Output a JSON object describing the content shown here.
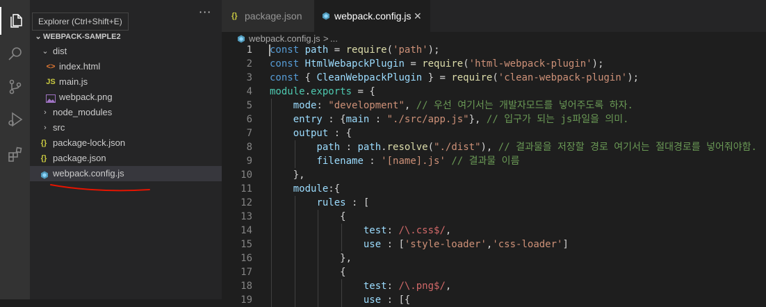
{
  "tooltip": "Explorer (Ctrl+Shift+E)",
  "sidebar": {
    "more": "···",
    "root": "WEBPACK-SAMPLE2",
    "items": [
      {
        "label": "dist",
        "kind": "folder-open"
      },
      {
        "label": "index.html",
        "kind": "html"
      },
      {
        "label": "main.js",
        "kind": "js"
      },
      {
        "label": "webpack.png",
        "kind": "image"
      },
      {
        "label": "node_modules",
        "kind": "folder"
      },
      {
        "label": "src",
        "kind": "folder"
      },
      {
        "label": "package-lock.json",
        "kind": "json"
      },
      {
        "label": "package.json",
        "kind": "json"
      },
      {
        "label": "webpack.config.js",
        "kind": "webpack",
        "selected": true
      }
    ]
  },
  "tabs": [
    {
      "label": "package.json",
      "icon": "{}"
    },
    {
      "label": "webpack.config.js",
      "icon": "webpack-icon",
      "active": true,
      "close": "✕"
    }
  ],
  "breadcrumb": {
    "file": "webpack.config.js",
    "sep": ">",
    "rest": "..."
  },
  "code": [
    {
      "n": "1",
      "tokens": [
        [
          "k",
          "const"
        ],
        [
          "p",
          " "
        ],
        [
          "v",
          "path"
        ],
        [
          "p",
          " = "
        ],
        [
          "f",
          "require"
        ],
        [
          "p",
          "("
        ],
        [
          "s",
          "'path'"
        ],
        [
          "p",
          ");"
        ]
      ]
    },
    {
      "n": "2",
      "tokens": [
        [
          "k",
          "const"
        ],
        [
          "p",
          " "
        ],
        [
          "v",
          "HtmlWebapckPlugin"
        ],
        [
          "p",
          " = "
        ],
        [
          "f",
          "require"
        ],
        [
          "p",
          "("
        ],
        [
          "s",
          "'html-webpack-plugin'"
        ],
        [
          "p",
          ");"
        ]
      ]
    },
    {
      "n": "3",
      "tokens": [
        [
          "k",
          "const"
        ],
        [
          "p",
          " { "
        ],
        [
          "v",
          "CleanWebpackPlugin"
        ],
        [
          "p",
          " } = "
        ],
        [
          "f",
          "require"
        ],
        [
          "p",
          "("
        ],
        [
          "s",
          "'clean-webpack-plugin'"
        ],
        [
          "p",
          ");"
        ]
      ]
    },
    {
      "n": "4",
      "tokens": [
        [
          "t",
          "module"
        ],
        [
          "p",
          "."
        ],
        [
          "t",
          "exports"
        ],
        [
          "p",
          " = {"
        ]
      ]
    },
    {
      "n": "5",
      "tokens": [
        [
          "p",
          "    "
        ],
        [
          "v",
          "mode"
        ],
        [
          "p",
          ": "
        ],
        [
          "s",
          "\"development\""
        ],
        [
          "p",
          ", "
        ],
        [
          "c",
          "// 우선 여기서는 개발자모드를 넣어주도록 하자."
        ]
      ]
    },
    {
      "n": "6",
      "tokens": [
        [
          "p",
          "    "
        ],
        [
          "v",
          "entry"
        ],
        [
          "p",
          " : {"
        ],
        [
          "v",
          "main"
        ],
        [
          "p",
          " : "
        ],
        [
          "s",
          "\"./src/app.js\""
        ],
        [
          "p",
          "}, "
        ],
        [
          "c",
          "// 입구가 되는 js파일을 의미."
        ]
      ]
    },
    {
      "n": "7",
      "tokens": [
        [
          "p",
          "    "
        ],
        [
          "v",
          "output"
        ],
        [
          "p",
          " : {"
        ]
      ]
    },
    {
      "n": "8",
      "tokens": [
        [
          "p",
          "        "
        ],
        [
          "v",
          "path"
        ],
        [
          "p",
          " : "
        ],
        [
          "v",
          "path"
        ],
        [
          "p",
          "."
        ],
        [
          "f",
          "resolve"
        ],
        [
          "p",
          "("
        ],
        [
          "s",
          "\"./dist\""
        ],
        [
          "p",
          "), "
        ],
        [
          "c",
          "// 결과물을 저장할 경로 여기서는 절대경로를 넣어줘야함."
        ]
      ]
    },
    {
      "n": "9",
      "tokens": [
        [
          "p",
          "        "
        ],
        [
          "v",
          "filename"
        ],
        [
          "p",
          " : "
        ],
        [
          "s",
          "'[name].js'"
        ],
        [
          "p",
          " "
        ],
        [
          "c",
          "// 결과물 이름"
        ]
      ]
    },
    {
      "n": "10",
      "tokens": [
        [
          "p",
          "    },"
        ]
      ]
    },
    {
      "n": "11",
      "tokens": [
        [
          "p",
          "    "
        ],
        [
          "v",
          "module"
        ],
        [
          "p",
          ":{"
        ]
      ]
    },
    {
      "n": "12",
      "tokens": [
        [
          "p",
          "        "
        ],
        [
          "v",
          "rules"
        ],
        [
          "p",
          " : ["
        ]
      ]
    },
    {
      "n": "13",
      "tokens": [
        [
          "p",
          "            {"
        ]
      ]
    },
    {
      "n": "14",
      "tokens": [
        [
          "p",
          "                "
        ],
        [
          "v",
          "test"
        ],
        [
          "p",
          ": "
        ],
        [
          "r",
          "/\\.css$/"
        ],
        [
          "p",
          ","
        ]
      ]
    },
    {
      "n": "15",
      "tokens": [
        [
          "p",
          "                "
        ],
        [
          "v",
          "use"
        ],
        [
          "p",
          " : ["
        ],
        [
          "s",
          "'style-loader'"
        ],
        [
          "p",
          ","
        ],
        [
          "s",
          "'css-loader'"
        ],
        [
          "p",
          "]"
        ]
      ]
    },
    {
      "n": "16",
      "tokens": [
        [
          "p",
          "            },"
        ]
      ]
    },
    {
      "n": "17",
      "tokens": [
        [
          "p",
          "            {"
        ]
      ]
    },
    {
      "n": "18",
      "tokens": [
        [
          "p",
          "                "
        ],
        [
          "v",
          "test"
        ],
        [
          "p",
          ": "
        ],
        [
          "r",
          "/\\.png$/"
        ],
        [
          "p",
          ","
        ]
      ]
    },
    {
      "n": "19",
      "tokens": [
        [
          "p",
          "                "
        ],
        [
          "v",
          "use"
        ],
        [
          "p",
          " : [{"
        ]
      ]
    }
  ],
  "colors": {
    "accent_red": "#e51400",
    "selection": "#37373d",
    "activity": "#333333"
  }
}
